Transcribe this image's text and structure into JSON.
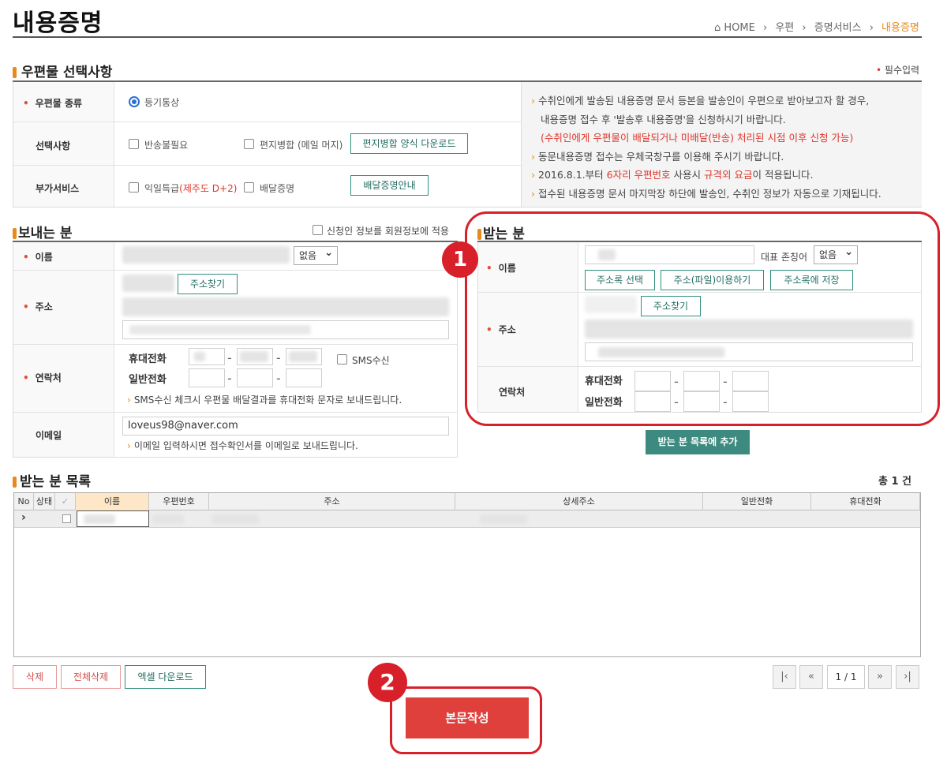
{
  "page": {
    "title": "내용증명"
  },
  "breadcrumb": {
    "home": "HOME",
    "level1": "우편",
    "level2": "증명서비스",
    "current": "내용증명"
  },
  "options_section": {
    "title": "우편물 선택사항",
    "required_note": "필수입력",
    "mail_type_label": "우편물 종류",
    "mail_type_value": "등기통상",
    "options_label": "선택사항",
    "no_return": "반송불필요",
    "mail_merge": "편지병합 (메일 머지)",
    "merge_download_button": "편지병합 양식 다운로드",
    "addons_label": "부가서비스",
    "next_day_prefix": "익일특급",
    "next_day_suffix": "(제주도 D+2)",
    "delivery_proof": "배달증명",
    "delivery_guide_button": "배달증명안내",
    "notes": [
      {
        "text": "수취인에게 발송된 내용증명 문서 등본을 발송인이 우편으로 받아보고자 할 경우,"
      },
      {
        "text": "내용증명 접수 후 '발송후 내용증명'을 신청하시기 바랍니다."
      },
      {
        "text": "(수취인에게 우편물이 배달되거나 미배달(반송) 처리된 시점 이후 신청 가능)"
      },
      {
        "text": "동문내용증명 접수는 우체국창구를 이용해 주시기 바랍니다."
      },
      {
        "pre": "2016.8.1.부터 ",
        "red1": "6자리 우편번호",
        "mid": " 사용시 ",
        "red2": "규격외 요금",
        "post": "이 적용됩니다."
      },
      {
        "text": "접수된 내용증명 문서 마지막장 하단에 발송인, 수취인 정보가 자동으로 기재됩니다."
      }
    ]
  },
  "sender": {
    "title": "보내는 분",
    "apply_member_info": "신청인 정보를 회원정보에 적용",
    "name_label": "이름",
    "honorific": "없음",
    "address_label": "주소",
    "find_address_button": "주소찾기",
    "contact_label": "연락처",
    "mobile_label": "휴대전화",
    "phone_label": "일반전화",
    "sms_label": "SMS수신",
    "sms_note": "SMS수신 체크시 우편물 배달결과를 휴대전화 문자로 보내드립니다.",
    "email_label": "이메일",
    "email_value": "loveus98@naver.com",
    "email_note": "이메일 입력하시면 접수확인서를 이메일로 보내드립니다."
  },
  "receiver": {
    "title": "받는 분",
    "name_label": "이름",
    "honorific_label": "대표 존칭어",
    "honorific": "없음",
    "address_book_button": "주소록 선택",
    "file_button": "주소(파일)이용하기",
    "save_book_button": "주소록에 저장",
    "address_label": "주소",
    "find_address_button": "주소찾기",
    "contact_label": "연락처",
    "mobile_label": "휴대전화",
    "phone_label": "일반전화",
    "add_button": "받는 분 목록에 추가"
  },
  "list_section": {
    "title": "받는 분 목록",
    "total": "총 1 건",
    "headers": [
      "No",
      "상태",
      "✓",
      "이름",
      "우편번호",
      "주소",
      "상세주소",
      "일반전화",
      "휴대전화"
    ],
    "row_marker": "›"
  },
  "bottom": {
    "delete_button": "삭제",
    "delete_all_button": "전체삭제",
    "excel_button": "엑셀 다운로드",
    "page_indicator": "1 / 1",
    "first": "|‹",
    "prev": "«",
    "next": "»",
    "last": "›|",
    "compose_button": "본문작성"
  },
  "annotations": {
    "step1": "1",
    "step2": "2"
  },
  "colors": {
    "accent": "#e8891e",
    "red": "#e0352b",
    "teal": "#3d8b80",
    "highlight_ring": "#d8202a"
  }
}
